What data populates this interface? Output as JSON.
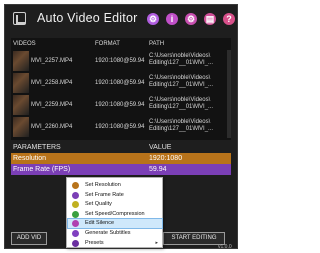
{
  "window": {
    "title": "Auto Video Editor",
    "version": "v1.0.0"
  },
  "toolbar_icons": [
    {
      "name": "gear-icon",
      "glyph": "⚙",
      "color": "#b15ee0"
    },
    {
      "name": "info-icon",
      "glyph": "i",
      "color": "#c04fc8"
    },
    {
      "name": "settings-icon",
      "glyph": "⚙",
      "color": "#c84fb0"
    },
    {
      "name": "document-icon",
      "glyph": "▤",
      "color": "#d04f98"
    },
    {
      "name": "help-icon",
      "glyph": "?",
      "color": "#d8508a"
    }
  ],
  "table": {
    "headers": {
      "videos": "VIDEOS",
      "format": "FORMAT",
      "path": "PATH"
    },
    "rows": [
      {
        "name": "MVI_2257.MP4",
        "format": "1920:1080@59.94",
        "path1": "C:\\Users\\noble\\Videos\\",
        "path2": "Editing\\127__01\\MVI_..."
      },
      {
        "name": "MVI_2258.MP4",
        "format": "1920:1080@59.94",
        "path1": "C:\\Users\\noble\\Videos\\",
        "path2": "Editing\\127__01\\MVI_..."
      },
      {
        "name": "MVI_2259.MP4",
        "format": "1920:1080@59.94",
        "path1": "C:\\Users\\noble\\Videos\\",
        "path2": "Editing\\127__01\\MVI_..."
      },
      {
        "name": "MVI_2260.MP4",
        "format": "1920:1080@59.94",
        "path1": "C:\\Users\\noble\\Videos\\",
        "path2": "Editing\\127__01\\MVI_..."
      }
    ]
  },
  "parameters": {
    "header_param": "PARAMETERS",
    "header_value": "VALUE",
    "rows": [
      {
        "label": "Resolution",
        "value": "1920:1080",
        "color": "#b8731a"
      },
      {
        "label": "Frame Rate (FPS)",
        "value": "59.94",
        "color": "#7b3fb6"
      }
    ]
  },
  "buttons": {
    "add": "ADD VID",
    "start": "START EDITING"
  },
  "context_menu": {
    "items": [
      {
        "label": "Set Resolution",
        "icon_color": "#b8731a",
        "highlighted": false
      },
      {
        "label": "Set Frame Rate",
        "icon_color": "#7b3fb6",
        "highlighted": false
      },
      {
        "label": "Set Quality",
        "icon_color": "#c0b020",
        "highlighted": false
      },
      {
        "label": "Set Speed/Compression",
        "icon_color": "#3aa040",
        "highlighted": false
      },
      {
        "label": "Edit Silence",
        "icon_color": "#b040b0",
        "highlighted": true
      },
      {
        "label": "Generate Subtitles",
        "icon_color": "#8040c0",
        "highlighted": false
      },
      {
        "label": "Presets",
        "icon_color": "#6a2fa0",
        "highlighted": false,
        "submenu_arrow": "▸"
      }
    ]
  }
}
